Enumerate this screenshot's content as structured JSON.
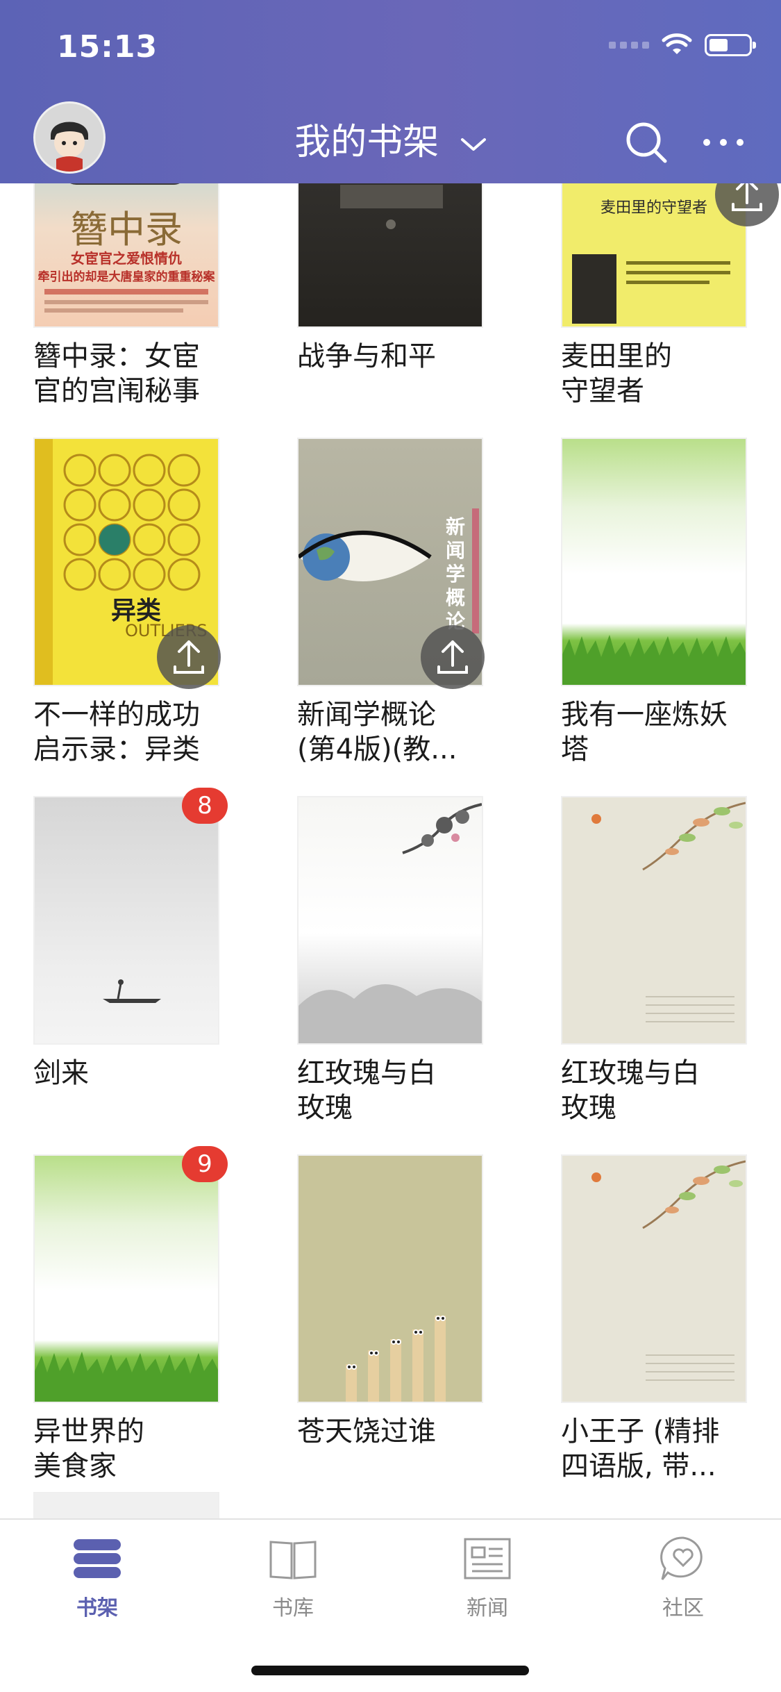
{
  "status_bar": {
    "time": "15:13"
  },
  "header": {
    "title": "我的书架",
    "icons": {
      "avatar": "avatar",
      "title_dropdown": "chevron-down-icon",
      "search": "search-icon",
      "more": "more-icon"
    }
  },
  "shelf": {
    "books": [
      {
        "title": "簪中录：女宦\n官的宫闱秘事",
        "cover_text": "簪中录",
        "cover_sub": "女宦官之爱恨情仇",
        "cover_sub2": "牵引出的却是大唐皇家的重重秘案",
        "upload": false,
        "badge": ""
      },
      {
        "title": "战争与和平",
        "cover_text": "",
        "upload": false,
        "badge": ""
      },
      {
        "title": "麦田里的\n守望者",
        "cover_text": "麦田里的守望者",
        "upload": true,
        "badge": ""
      },
      {
        "title": "不一样的成功\n启示录：异类",
        "cover_text": "异类",
        "cover_sub": "OUTLIERS",
        "upload": true,
        "badge": ""
      },
      {
        "title": "新闻学概论\n(第4版)(教...",
        "cover_text": "新闻学概论",
        "upload": true,
        "badge": ""
      },
      {
        "title": "我有一座炼妖\n塔",
        "cover_text": "",
        "upload": false,
        "badge": ""
      },
      {
        "title": "剑来",
        "cover_text": "",
        "upload": false,
        "badge": "8"
      },
      {
        "title": "红玫瑰与白\n玫瑰",
        "cover_text": "",
        "upload": false,
        "badge": ""
      },
      {
        "title": "红玫瑰与白\n玫瑰",
        "cover_text": "",
        "upload": false,
        "badge": ""
      },
      {
        "title": "异世界的\n美食家",
        "cover_text": "",
        "upload": false,
        "badge": "9"
      },
      {
        "title": "苍天饶过谁",
        "cover_text": "",
        "upload": false,
        "badge": ""
      },
      {
        "title": "小王子 (精排\n四语版, 带...",
        "cover_text": "",
        "upload": false,
        "badge": ""
      }
    ]
  },
  "tabbar": {
    "tabs": [
      {
        "label": "书架",
        "icon": "bookshelf-icon",
        "active": true
      },
      {
        "label": "书库",
        "icon": "library-book-icon",
        "active": false
      },
      {
        "label": "新闻",
        "icon": "news-icon",
        "active": false
      },
      {
        "label": "社区",
        "icon": "community-heart-icon",
        "active": false
      }
    ]
  },
  "colors": {
    "header": "#6266b6",
    "accent": "#5b60b0",
    "badge": "#e53b31"
  }
}
